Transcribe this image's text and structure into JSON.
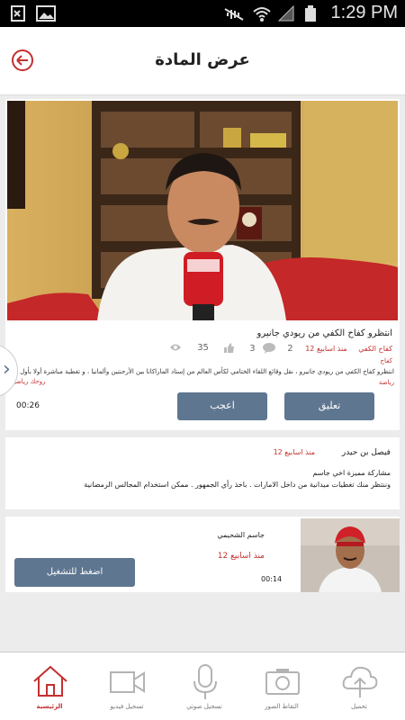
{
  "status_bar": {
    "time": "1:29 PM"
  },
  "header": {
    "title": "عرض المادة"
  },
  "video": {
    "title": "انتظرو كفاح الكفي من ريودي جانيرو",
    "author": "كفاح الكفي",
    "time_ago": "منذ اسابيع 12",
    "category": "كفاح",
    "views": "35",
    "likes": "3",
    "comments": "2",
    "description": "انتظرو كفاح الكفي من ريودي جانيرو ، نقل وقائع اللقاء الختامي لكأس العالم من إستاد الماراكانا بين الأرجنتين وألمانيا ، و تغطية مباشرة أولا بأول",
    "tag_left": "روحك رياضية",
    "tag_right": "رياضة",
    "duration": "00:26",
    "comment_label": "تعليق",
    "like_label": "اعجب"
  },
  "comment": {
    "name": "فيصل بن حيدر",
    "time_ago": "منذ اسابيع 12",
    "line1": "مشاركة مميزة اخي جاسم",
    "line2": "وننتظر منك تغطيات ميدانية من داخل الامارات . باخذ رأي الجمهور . ممكن استخدام المجالس الرمضانية"
  },
  "reply_video": {
    "name": "جاسم الشحيمي",
    "time_ago": "منذ اسابيع 12",
    "duration": "00:14",
    "play_label": "اضغط للتشغيل"
  },
  "bottom_nav": {
    "items": [
      {
        "label": "تحميل",
        "icon": "upload-cloud-icon"
      },
      {
        "label": "التقاط الصور",
        "icon": "camera-icon"
      },
      {
        "label": "تسجيل صوتي",
        "icon": "microphone-icon"
      },
      {
        "label": "تسجيل فيديو",
        "icon": "video-camera-icon"
      },
      {
        "label": "الرئيسية",
        "icon": "home-icon"
      }
    ]
  },
  "colors": {
    "accent": "#c4302f",
    "button": "#5e7690",
    "background": "#ececec"
  }
}
